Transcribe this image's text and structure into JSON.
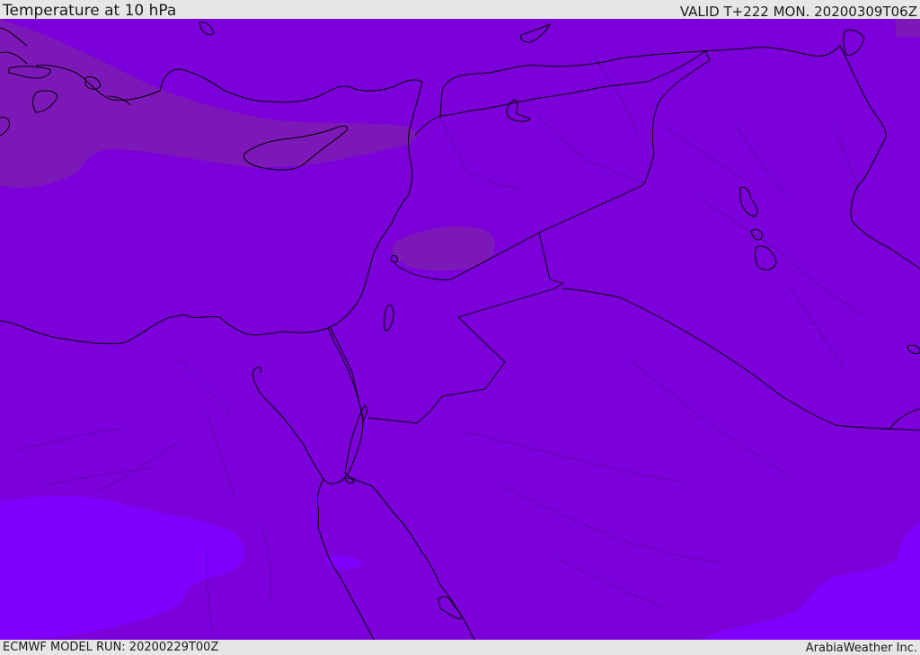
{
  "header": {
    "title": "Temperature at 10 hPa",
    "valid": "VALID T+222 MON. 20200309T06Z"
  },
  "footer": {
    "model_run": "ECMWF MODEL RUN: 20200229T00Z",
    "credit": "ArabiaWeather Inc."
  },
  "map": {
    "colors": {
      "base_field": "#7b00d9",
      "warmer_band": "#7d18b8",
      "colder_band": "#7f00ff",
      "coastline": "#000000"
    }
  }
}
